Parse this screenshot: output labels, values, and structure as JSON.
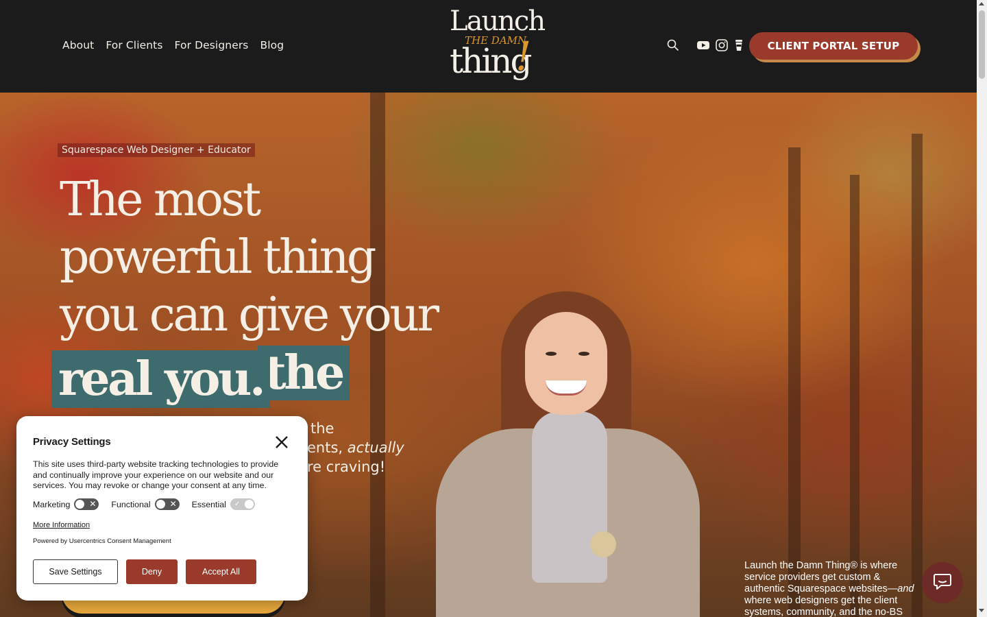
{
  "nav": {
    "items": [
      "About",
      "For Clients",
      "For Designers",
      "Blog"
    ]
  },
  "logo": {
    "line1": "Launch",
    "line2": "THE DAMN",
    "line3": "thing",
    "line4": "!"
  },
  "header_icons": [
    "search-icon",
    "youtube-icon",
    "instagram-icon",
    "coffee-cup-icon"
  ],
  "portal_button": "CLIENT PORTAL SETUP",
  "hero": {
    "eyebrow": "Squarespace Web Designer + Educator",
    "headline_part1": "The most powerful thing you can give your clients is",
    "headline_highlight1": "the",
    "headline_highlight2": "real you.",
    "sub_line1": "the",
    "sub_line2": "ents,",
    "sub_line2_italic": "actually",
    "sub_line3": "re craving!",
    "about_text": "Launch the Damn Thing® is where service providers get custom & authentic Squarespace websites—",
    "about_italic": "and",
    "about_text2": "where web designers get the client systems, community, and the no-BS"
  },
  "privacy": {
    "title": "Privacy Settings",
    "description": "This site uses third-party website tracking technologies to provide and continually improve your experience on our website and our services. You may revoke or change your consent at any time.",
    "toggles": [
      {
        "label": "Marketing",
        "state": "off"
      },
      {
        "label": "Functional",
        "state": "off"
      },
      {
        "label": "Essential",
        "state": "on"
      }
    ],
    "more_info": "More Information",
    "powered_by": "Powered by Usercentrics Consent Management",
    "save_label": "Save Settings",
    "deny_label": "Deny",
    "accept_label": "Accept All"
  },
  "colors": {
    "header_bg": "#1b1b1b",
    "brand_red": "#9a3a2b",
    "accent_gold": "#d9972e",
    "highlight_teal": "#3e6c6e"
  }
}
